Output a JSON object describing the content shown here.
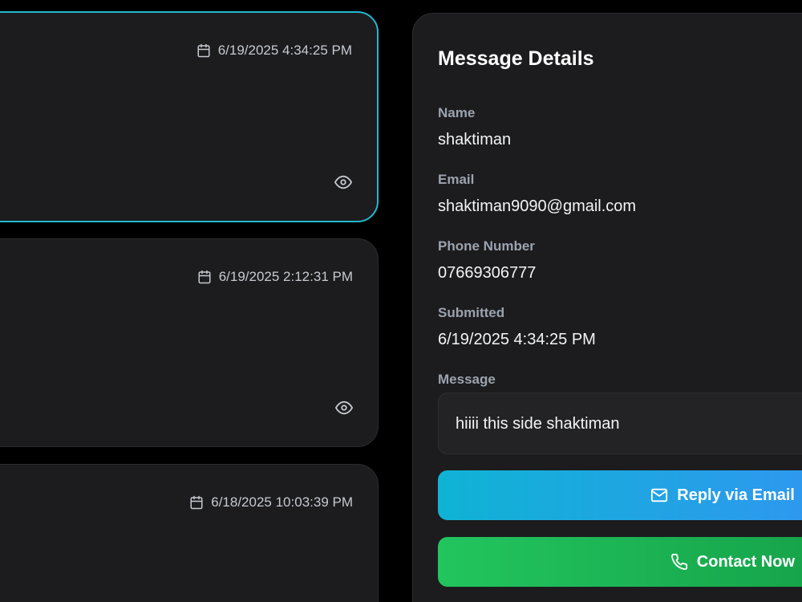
{
  "messages": [
    {
      "date": "6/19/2025 4:34:25 PM",
      "selected": true
    },
    {
      "date": "6/19/2025 2:12:31 PM",
      "selected": false
    },
    {
      "date": "6/18/2025 10:03:39 PM",
      "selected": false
    }
  ],
  "details": {
    "title": "Message Details",
    "name_label": "Name",
    "name": "shaktiman",
    "email_label": "Email",
    "email": "shaktiman9090@gmail.com",
    "phone_label": "Phone Number",
    "phone": "07669306777",
    "submitted_label": "Submitted",
    "submitted": "6/19/2025 4:34:25 PM",
    "message_label": "Message",
    "message": "hiiii this side shaktiman"
  },
  "actions": {
    "reply_label": "Reply via Email",
    "contact_label": "Contact Now"
  },
  "colors": {
    "accent_cyan": "#22b8cf",
    "reply_gradient_start": "#0fb3d4",
    "reply_gradient_end": "#2f97f0",
    "contact_gradient_start": "#22c55e",
    "contact_gradient_end": "#16a34a",
    "card_bg": "#1c1c1e"
  },
  "icons": {
    "date": "calendar-icon",
    "view": "eye-icon",
    "reply": "mail-icon",
    "contact": "phone-icon"
  }
}
